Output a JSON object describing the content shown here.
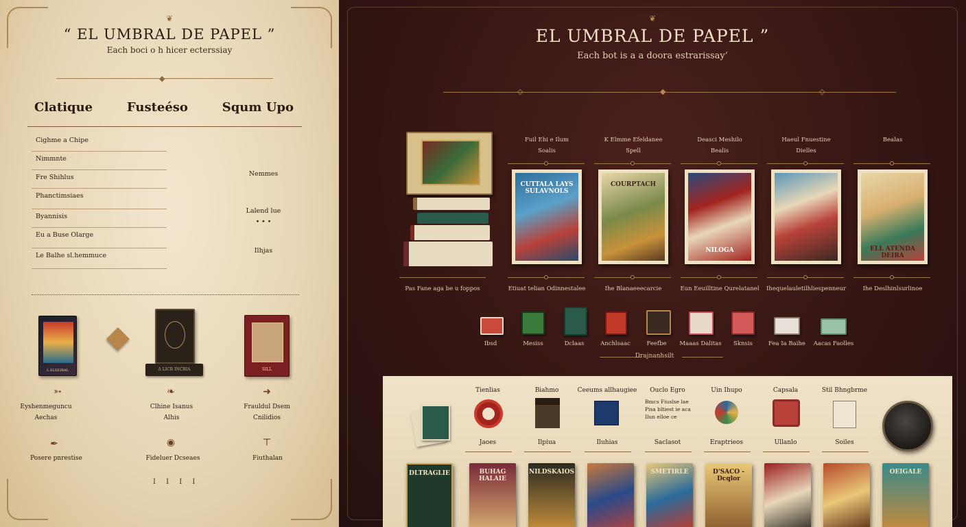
{
  "left": {
    "title": "“ EL UMBRAL DE PAPEL ”",
    "subtitle": "Each boci o h hicer ecterssiay",
    "columns": [
      "Clatique",
      "Fusteéso",
      "Squm Upo"
    ],
    "list": [
      "Cighme a Chipe",
      "Nimmnte",
      "Fre Shihlus",
      "Phanctimsiaes",
      "Byannisis",
      "Eu a Buse Olarge",
      "Le Balhe sl.hemmuce"
    ],
    "side_notes": [
      "Nemmes",
      "Lalend lue",
      "• • •",
      "Ilhjas"
    ],
    "shop_captions": [
      [
        "Eyshenmeguncu",
        "Aechas"
      ],
      [
        "Clhine Isanus",
        "Alhis"
      ],
      [
        "Frauldul Dsem",
        "Cnilidios"
      ]
    ],
    "bottom_captions": [
      "Posere pnrestise",
      "Fideluer Dcseaes",
      "Fiuthalan"
    ],
    "pager": "I I I I",
    "book_labels": [
      "L ELEEIRAL",
      "A LICR INCRIA",
      "SILL"
    ]
  },
  "right": {
    "title": "EL UMBRAL DE PAPEL ”",
    "subtitle": "Each bot is a a doora estrarissay’",
    "products": [
      {
        "head": [
          "Fuil Ehi e Ilum",
          "Soalis"
        ],
        "cover": "CUTTALA LAYS SULAVNOLS",
        "caption": "Etiuat telian Odinnestalee",
        "colors": [
          "#2c6f9c",
          "#b8423a"
        ]
      },
      {
        "head": [
          "K Elmme Efeldanee",
          "Spell"
        ],
        "cover": "COURPTACH",
        "caption": "Ihe Blanaeeecarcie",
        "colors": [
          "#7a8a4a",
          "#c8923a"
        ]
      },
      {
        "head": [
          "Deasci Meshilo",
          "Bealis"
        ],
        "cover": "NILOGA",
        "caption": "Eun Eeuilltine Qurelatanel",
        "colors": [
          "#a3241f",
          "#2b4a7a"
        ]
      },
      {
        "head": [
          "Haeul Fnuestine",
          "Dielles"
        ],
        "cover": "",
        "caption": "Ihequelauletilhliespenneur",
        "colors": [
          "#5a98b8",
          "#b8423a"
        ]
      },
      {
        "head": [
          "",
          "Bealas"
        ],
        "cover": "ELL ATENDA DEIRA",
        "caption": "Ihe Deslhinlsurlinoe",
        "colors": [
          "#e8d6a8",
          "#3a7a5a"
        ]
      }
    ],
    "stack_caption": "Pas Fane aga be u foppos",
    "minis": [
      {
        "label": "Ibsd",
        "color": "#c94a3a"
      },
      {
        "label": "Mesiss",
        "color": "#3a7a3a"
      },
      {
        "label": "Dclaas",
        "color": "#2a5a4a"
      },
      {
        "label": "Anchlsaac",
        "color": "#c23a2a"
      },
      {
        "label": "Feefbe",
        "color": "#3a2a22"
      },
      {
        "label": "Maaas Dalitas",
        "color": "#e8d8c8"
      },
      {
        "label": "Sknsis",
        "color": "#d45a5a"
      },
      {
        "label": "Fea Ia Baihe",
        "color": "#e8e0d8"
      },
      {
        "label": "Aacas Faolles",
        "color": "#9ac2a8"
      }
    ],
    "divider_label": "Drajnanhsilt",
    "categories": [
      {
        "head": "Tienlias",
        "caption": "Jaoes"
      },
      {
        "head": "Biahmo",
        "caption": "Ilpiua"
      },
      {
        "head": "Ceeums allhaugiee",
        "caption": "Iluhias"
      },
      {
        "head": "Ouclo Egro",
        "caption": "Saclasot",
        "lines": [
          "Bmcs  Fiuslse lae",
          "Pisa  bltiest ie aca",
          "Ilun  elloe ce"
        ]
      },
      {
        "head": "Uin Ihupo",
        "caption": "Eraptrieos"
      },
      {
        "head": "Capsala",
        "caption": "Ullanlo"
      },
      {
        "head": "Stil Bhngbrme",
        "caption": "Soiles"
      }
    ],
    "bottom_books": [
      {
        "title": "DLTRAGLIE",
        "color": "#1f3a2a"
      },
      {
        "title": "BUHAG HALAIE",
        "color": "#7a2a3a"
      },
      {
        "title": "NILDSKAIOS",
        "color": "#2a2a22"
      },
      {
        "title": "",
        "color": "#c87a3a"
      },
      {
        "title": "SMETIRLE",
        "color": "#2a6a9a"
      },
      {
        "title": "D'SACO - Dcqlor",
        "color": "#e8c878"
      },
      {
        "title": "",
        "color": "#9a1f1f"
      },
      {
        "title": "",
        "color": "#b84a2a"
      },
      {
        "title": "OEIGALE",
        "color": "#3a8a8a"
      }
    ]
  }
}
